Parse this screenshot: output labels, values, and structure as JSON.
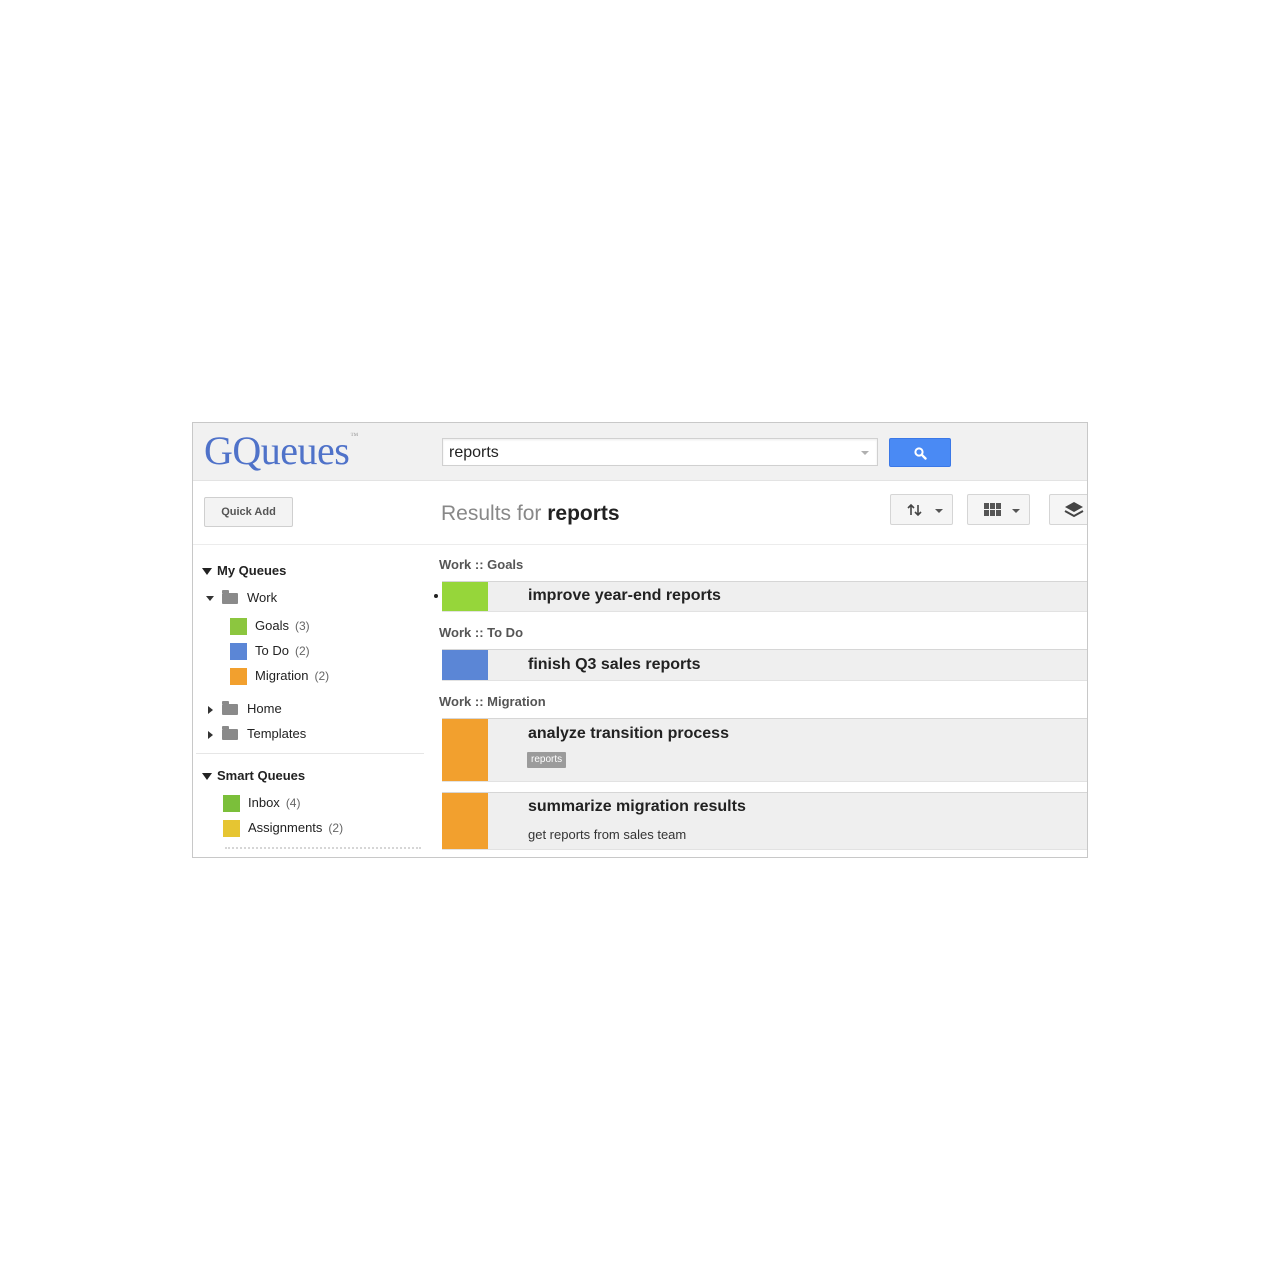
{
  "app": {
    "logo_text": "GQueues",
    "logo_tm": "™"
  },
  "search": {
    "value": "reports",
    "button_icon": "search-icon"
  },
  "toolbar": {
    "quick_add_label": "Quick Add",
    "results_prefix": "Results for",
    "results_query": "reports",
    "sort_icon": "sort-icon",
    "view_icon": "grid-view-icon",
    "layers_icon": "layers-icon"
  },
  "sidebar": {
    "my_queues_label": "My Queues",
    "work": {
      "label": "Work"
    },
    "work_queues": [
      {
        "label": "Goals",
        "count": "(3)",
        "color": "#8cc63f"
      },
      {
        "label": "To Do",
        "count": "(2)",
        "color": "#5b86d6"
      },
      {
        "label": "Migration",
        "count": "(2)",
        "color": "#f2a02e"
      }
    ],
    "folders": [
      {
        "label": "Home"
      },
      {
        "label": "Templates"
      }
    ],
    "smart_queues_label": "Smart Queues",
    "smart_queues": [
      {
        "label": "Inbox",
        "count": "(4)",
        "color": "#7bbf3a"
      },
      {
        "label": "Assignments",
        "count": "(2)",
        "color": "#e6c532"
      }
    ]
  },
  "results": {
    "groups": [
      {
        "label": "Work :: Goals",
        "tasks": [
          {
            "title": "improve year-end reports",
            "color": "#96d63a"
          }
        ]
      },
      {
        "label": "Work :: To Do",
        "tasks": [
          {
            "title": "finish Q3 sales reports",
            "color": "#5b86d6"
          }
        ]
      },
      {
        "label": "Work :: Migration",
        "tasks": [
          {
            "title": "analyze transition process",
            "tag": "reports",
            "color": "#f2a02e"
          },
          {
            "title": "summarize migration results",
            "note": "get reports from sales team",
            "color": "#f2a02e"
          }
        ]
      }
    ]
  }
}
